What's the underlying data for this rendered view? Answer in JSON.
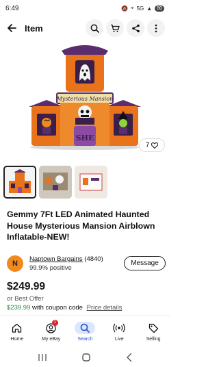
{
  "status": {
    "time": "6:49",
    "network": "5G",
    "battery": "80"
  },
  "header": {
    "title": "Item"
  },
  "hero": {
    "sign_text": "Mysterious Mansion",
    "door_text": "SHE",
    "image_counter": "7",
    "colors": {
      "orange": "#e8731a",
      "purple": "#5b2d6e",
      "green": "#8ed43a"
    }
  },
  "thumbnails": [
    {
      "name": "thumb-1",
      "active": true
    },
    {
      "name": "thumb-2",
      "active": false
    },
    {
      "name": "thumb-3",
      "active": false
    }
  ],
  "listing": {
    "title": "Gemmy 7Ft LED Animated Haunted House Mysterious Mansion Airblown Inflatable-NEW!"
  },
  "seller": {
    "initial": "N",
    "name": "Naptown Bargains",
    "feedback_count": "(4840)",
    "positive": "99.9% positive",
    "message_label": "Message"
  },
  "price": {
    "amount": "$249.99",
    "best_offer": "or Best Offer",
    "coupon_price": "$239.99",
    "coupon_text": "with coupon code",
    "details_link": "Price details"
  },
  "bottom_nav": {
    "items": [
      {
        "label": "Home",
        "icon": "home-icon"
      },
      {
        "label": "My eBay",
        "icon": "profile-icon",
        "badge": "1"
      },
      {
        "label": "Search",
        "icon": "search-icon",
        "active": true
      },
      {
        "label": "Live",
        "icon": "live-icon"
      },
      {
        "label": "Selling",
        "icon": "tag-icon"
      }
    ]
  }
}
